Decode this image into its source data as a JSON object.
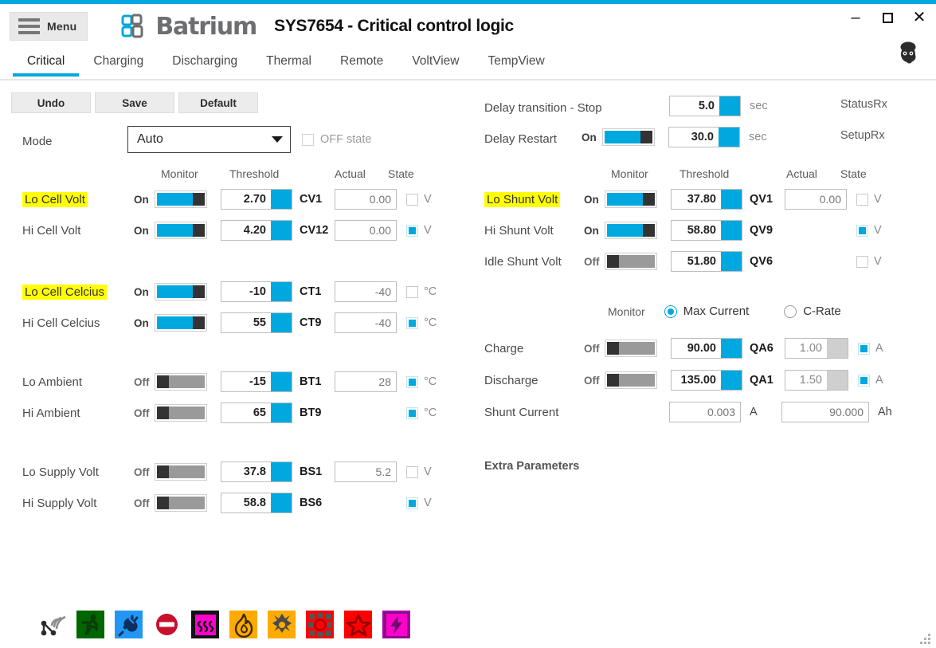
{
  "window": {
    "menu_label": "Menu",
    "brand": "Batrium",
    "title": "SYS7654 - Critical control logic",
    "minimize": "–",
    "close": "✕",
    "accent_color": "#00a8e0",
    "highlight_color": "#ffff00"
  },
  "tabs": [
    {
      "label": "Critical",
      "active": true
    },
    {
      "label": "Charging",
      "active": false
    },
    {
      "label": "Discharging",
      "active": false
    },
    {
      "label": "Thermal",
      "active": false
    },
    {
      "label": "Remote",
      "active": false
    },
    {
      "label": "VoltView",
      "active": false
    },
    {
      "label": "TempView",
      "active": false
    }
  ],
  "toolbar": {
    "undo": "Undo",
    "save": "Save",
    "default": "Default"
  },
  "mode": {
    "label": "Mode",
    "value": "Auto",
    "offstate_label": "OFF state",
    "offstate_checked": false
  },
  "left": {
    "headers": {
      "monitor": "Monitor",
      "threshold": "Threshold",
      "actual": "Actual",
      "state": "State"
    },
    "rows": [
      {
        "label": "Lo Cell Volt",
        "highlight": true,
        "monitor": "On",
        "threshold": "2.70",
        "code": "CV1",
        "actual": "0.00",
        "state_on": false,
        "unit": "V",
        "has_actual": true
      },
      {
        "label": "Hi Cell Volt",
        "highlight": false,
        "monitor": "On",
        "threshold": "4.20",
        "code": "CV12",
        "actual": "0.00",
        "state_on": true,
        "unit": "V",
        "has_actual": true
      },
      {
        "label": "Lo Cell Celcius",
        "highlight": true,
        "monitor": "On",
        "threshold": "-10",
        "code": "CT1",
        "actual": "-40",
        "state_on": false,
        "unit": "°C",
        "has_actual": true
      },
      {
        "label": "Hi Cell Celcius",
        "highlight": false,
        "monitor": "On",
        "threshold": "55",
        "code": "CT9",
        "actual": "-40",
        "state_on": true,
        "unit": "°C",
        "has_actual": true
      },
      {
        "label": "Lo Ambient",
        "highlight": false,
        "monitor": "Off",
        "threshold": "-15",
        "code": "BT1",
        "actual": "28",
        "state_on": true,
        "unit": "°C",
        "has_actual": true
      },
      {
        "label": "Hi Ambient",
        "highlight": false,
        "monitor": "Off",
        "threshold": "65",
        "code": "BT9",
        "actual": "",
        "state_on": true,
        "unit": "°C",
        "has_actual": false
      },
      {
        "label": "Lo Supply Volt",
        "highlight": false,
        "monitor": "Off",
        "threshold": "37.8",
        "code": "BS1",
        "actual": "5.2",
        "state_on": false,
        "unit": "V",
        "has_actual": true
      },
      {
        "label": "Hi Supply Volt",
        "highlight": false,
        "monitor": "Off",
        "threshold": "58.8",
        "code": "BS6",
        "actual": "",
        "state_on": true,
        "unit": "V",
        "has_actual": false
      }
    ]
  },
  "right": {
    "delay_stop": {
      "label": "Delay transition - Stop",
      "value": "5.0",
      "unit": "sec",
      "has_toggle": false,
      "monitor": ""
    },
    "delay_restart": {
      "label": "Delay Restart",
      "value": "30.0",
      "unit": "sec",
      "has_toggle": true,
      "monitor": "On"
    },
    "status_rx": "StatusRx",
    "setup_rx": "SetupRx",
    "headers": {
      "monitor": "Monitor",
      "threshold": "Threshold",
      "actual": "Actual",
      "state": "State"
    },
    "shunt_rows": [
      {
        "label": "Lo Shunt Volt",
        "highlight": true,
        "monitor": "On",
        "threshold": "37.80",
        "code": "QV1",
        "actual": "0.00",
        "state_on": false,
        "unit": "V",
        "has_actual": true
      },
      {
        "label": "Hi Shunt Volt",
        "highlight": false,
        "monitor": "On",
        "threshold": "58.80",
        "code": "QV9",
        "actual": "",
        "state_on": true,
        "unit": "V",
        "has_actual": false
      },
      {
        "label": "Idle Shunt Volt",
        "highlight": false,
        "monitor": "Off",
        "threshold": "51.80",
        "code": "QV6",
        "actual": "",
        "state_on": false,
        "unit": "V",
        "has_actual": false
      }
    ],
    "monitor_mode": {
      "label": "Monitor",
      "options": [
        {
          "label": "Max Current",
          "selected": true
        },
        {
          "label": "C-Rate",
          "selected": false
        }
      ]
    },
    "current_rows": [
      {
        "label": "Charge",
        "monitor": "Off",
        "threshold": "90.00",
        "code": "QA6",
        "actual": "1.00",
        "state_on": true,
        "unit": "A"
      },
      {
        "label": "Discharge",
        "monitor": "Off",
        "threshold": "135.00",
        "code": "QA1",
        "actual": "1.50",
        "state_on": true,
        "unit": "A"
      }
    ],
    "shunt_current": {
      "label": "Shunt Current",
      "amps": "0.003",
      "amps_unit": "A",
      "ah": "90.000",
      "ah_unit": "Ah"
    },
    "extra_parameters": "Extra Parameters"
  },
  "statusbar": {
    "icons": [
      {
        "name": "network-signal-icon",
        "bg": "transparent",
        "fg": "#333333"
      },
      {
        "name": "running-person-icon",
        "bg": "#006600",
        "fg": "#0d3d0d"
      },
      {
        "name": "power-plug-icon",
        "bg": "#2196f3",
        "fg": "#0d2f5e"
      },
      {
        "name": "no-entry-icon",
        "bg": "#ffffff",
        "fg": "#cc0022"
      },
      {
        "name": "heat-waves-icon",
        "bg": "#ff00cc",
        "fg": "#111111"
      },
      {
        "name": "flame-icon",
        "bg": "#ffaa00",
        "fg": "#332200"
      },
      {
        "name": "snowflake-icon",
        "bg": "#ffaa00",
        "fg": "#4a4a4a"
      },
      {
        "name": "alarm-target-icon",
        "bg": "#ff0000",
        "fg": "#5c5c5c"
      },
      {
        "name": "star-icon",
        "bg": "#ff0000",
        "fg": "#8a0000"
      },
      {
        "name": "lightning-bolt-icon",
        "bg": "#ff00cc",
        "fg": "#6a0d6a"
      }
    ]
  }
}
